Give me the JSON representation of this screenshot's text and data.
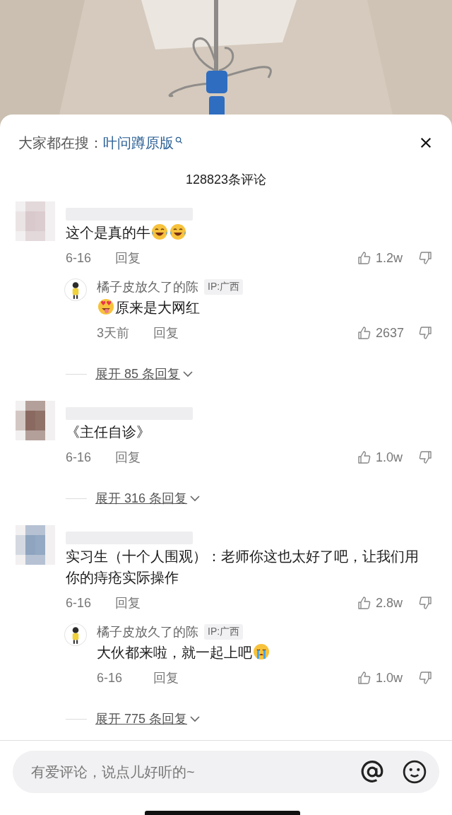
{
  "search_bar": {
    "label": "大家都在搜：",
    "keyword": "叶问蹲原版"
  },
  "comment_count": "128823条评论",
  "comments": [
    {
      "text": "这个是真的牛",
      "emoji_after": [
        {
          "kind": "laugh"
        },
        {
          "kind": "laugh"
        }
      ],
      "date": "6-16",
      "reply": "回复",
      "likes": "1.2w",
      "replies": [
        {
          "name": "橘子皮放久了的陈",
          "ip": "IP:广西",
          "text": "原来是大网红",
          "emoji_before": [
            {
              "kind": "heart-eyes"
            }
          ],
          "date": "3天前",
          "reply": "回复",
          "likes": "2637"
        }
      ],
      "expand": "展开 85 条回复"
    },
    {
      "text": "《主任自诊》",
      "date": "6-16",
      "reply": "回复",
      "likes": "1.0w",
      "expand": "展开 316 条回复"
    },
    {
      "text": "实习生（十个人围观）：老师你这也太好了吧，让我们用你的痔疮实际操作",
      "date": "6-16",
      "reply": "回复",
      "likes": "2.8w",
      "replies": [
        {
          "name": "橘子皮放久了的陈",
          "ip": "IP:广西",
          "text": "大伙都来啦，就一起上吧",
          "emoji_after": [
            {
              "kind": "crying"
            }
          ],
          "date": "6-16",
          "reply": "回复",
          "likes": "1.0w"
        }
      ],
      "expand": "展开 775 条回复"
    }
  ],
  "input": {
    "placeholder": "有爱评论，说点儿好听的~"
  }
}
